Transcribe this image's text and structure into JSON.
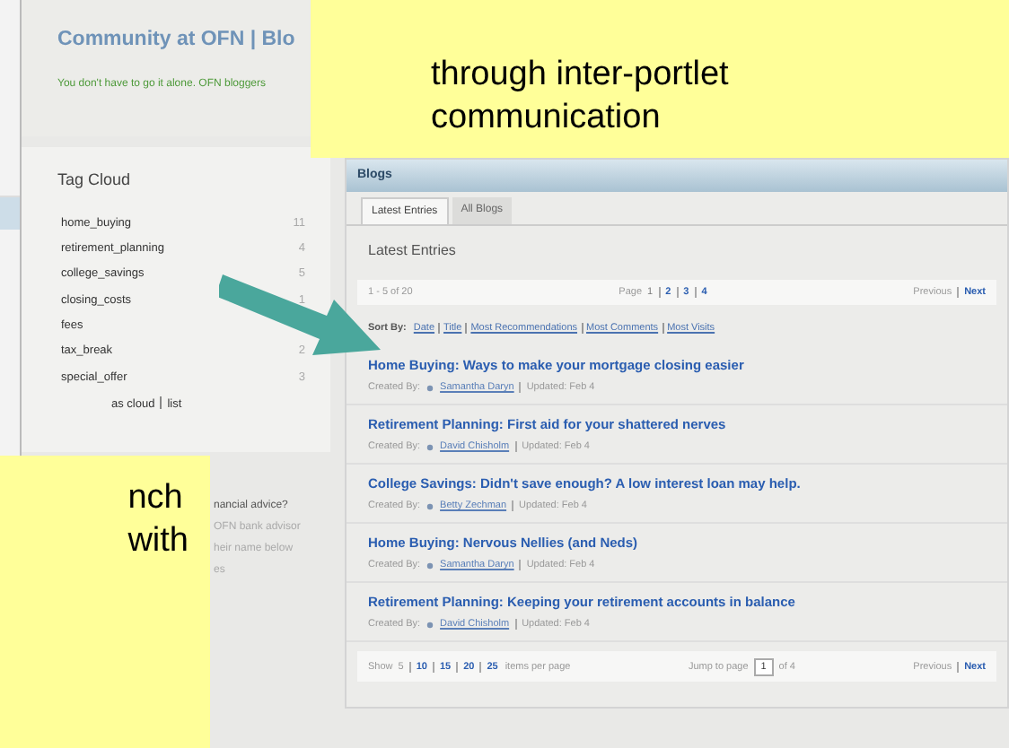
{
  "header": {
    "title": "Community at OFN | Blo",
    "tagline": "You don't have to go it alone. OFN bloggers"
  },
  "tag_cloud": {
    "title": "Tag Cloud",
    "tags": [
      {
        "name": "home_buying",
        "count": "11"
      },
      {
        "name": "retirement_planning",
        "count": "4"
      },
      {
        "name": "college_savings",
        "count": "5"
      },
      {
        "name": "closing_costs",
        "count": "1"
      },
      {
        "name": "fees"
      },
      {
        "name": "tax_break",
        "count": "2"
      },
      {
        "name": "special_offer",
        "count": "3"
      }
    ],
    "view_links": [
      "as cloud",
      "list"
    ]
  },
  "side_text": [
    "nancial advice?",
    "OFN bank advisor",
    "heir name below",
    "es"
  ],
  "blogs": {
    "title": "Blogs",
    "tabs": [
      {
        "label": "Latest Entries",
        "selected": true
      },
      {
        "label": "All Blogs",
        "selected": false
      }
    ],
    "heading": "Latest Entries",
    "range": "1 - 5 of 20",
    "page_label": "Page",
    "pages": [
      {
        "label": "1",
        "selected": true
      },
      {
        "label": "2",
        "selected": false
      },
      {
        "label": "3",
        "selected": false
      },
      {
        "label": "4",
        "selected": false
      }
    ],
    "prev": {
      "label": "Previous",
      "disabled": true
    },
    "next": {
      "label": "Next",
      "disabled": false
    },
    "sort_label": "Sort By:",
    "sort_options": [
      "Date",
      "Title",
      "Most Recommendations",
      "Most Comments",
      "Most Visits"
    ],
    "entries": [
      {
        "title": "Home Buying: Ways to make your mortgage closing easier",
        "created_label": "Created By:",
        "author": "Samantha Daryn",
        "updated": "Updated: Feb 4"
      },
      {
        "title": "Retirement Planning: First aid for your shattered nerves",
        "created_label": "Created By:",
        "author": "David Chisholm",
        "updated": "Updated: Feb 4"
      },
      {
        "title": "College Savings: Didn't save enough? A low interest loan may help.",
        "created_label": "Created By:",
        "author": "Betty Zechman",
        "updated": "Updated: Feb 4"
      },
      {
        "title": "Home Buying: Nervous Nellies (and Neds)",
        "created_label": "Created By:",
        "author": "Samantha Daryn",
        "updated": "Updated: Feb 4"
      },
      {
        "title": "Retirement Planning: Keeping your retirement accounts in balance",
        "created_label": "Created By:",
        "author": "David Chisholm",
        "updated": "Updated: Feb 4"
      }
    ],
    "footer": {
      "show_label": "Show",
      "sizes": [
        {
          "label": "5",
          "selected": true
        },
        {
          "label": "10",
          "selected": false
        },
        {
          "label": "15",
          "selected": false
        },
        {
          "label": "20",
          "selected": false
        },
        {
          "label": "25",
          "selected": false
        }
      ],
      "per_page": "items per page",
      "jump_label": "Jump to page",
      "jump_value": "1",
      "of": "of 4",
      "prev": {
        "label": "Previous",
        "disabled": true
      },
      "next": {
        "label": "Next",
        "disabled": false
      }
    }
  },
  "callouts": [
    {
      "lines": [
        "through inter-portlet",
        "communication"
      ]
    },
    {
      "lines": [
        "nch",
        "with"
      ]
    }
  ]
}
